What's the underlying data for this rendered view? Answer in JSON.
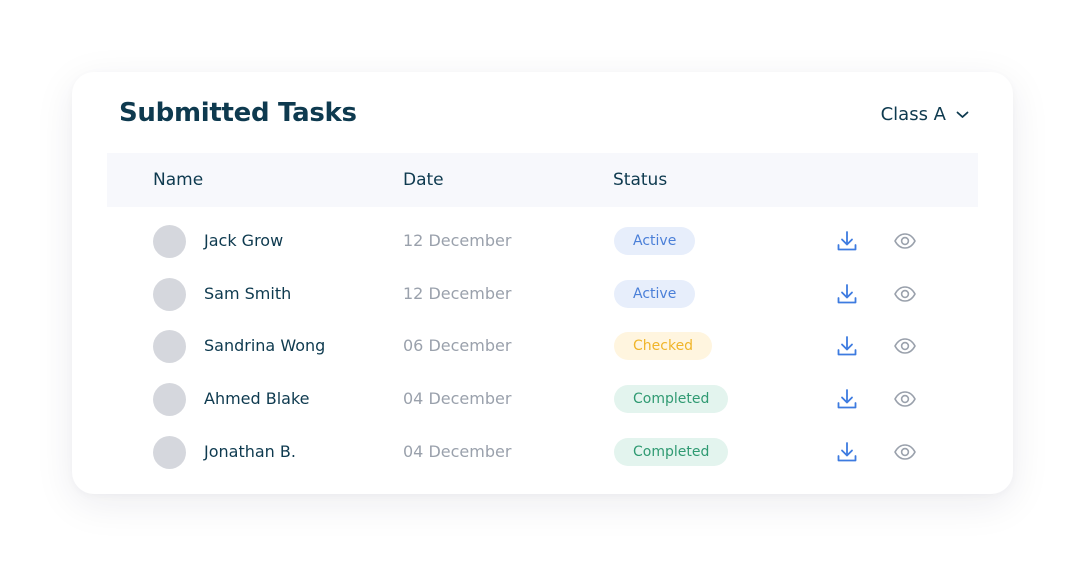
{
  "header": {
    "title": "Submitted Tasks",
    "class_selector": "Class A"
  },
  "table": {
    "columns": [
      "Name",
      "Date",
      "Status"
    ],
    "rows": [
      {
        "name": "Jack Grow",
        "date": "12 December",
        "status": "Active"
      },
      {
        "name": "Sam Smith",
        "date": "12 December",
        "status": "Active"
      },
      {
        "name": "Sandrina Wong",
        "date": "06 December",
        "status": "Checked"
      },
      {
        "name": "Ahmed Blake",
        "date": "04 December",
        "status": "Completed"
      },
      {
        "name": "Jonathan B.",
        "date": "04 December",
        "status": "Completed"
      }
    ]
  },
  "icons": {
    "class_dropdown": "chevron-down-icon",
    "row_actions": [
      "download-icon",
      "eye-icon"
    ]
  },
  "colors": {
    "title": "#0e3a4f",
    "active_text": "#4a7fd8",
    "active_bg": "#e7eefb",
    "checked_text": "#f0b52a",
    "checked_bg": "#fff5df",
    "completed_text": "#2f9a72",
    "completed_bg": "#e3f4ee",
    "download_icon": "#3d7be0",
    "eye_icon": "#9aa1ac"
  }
}
